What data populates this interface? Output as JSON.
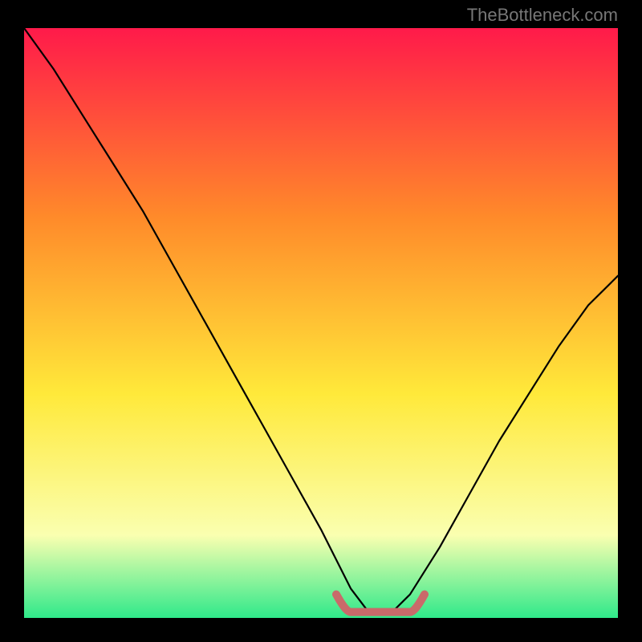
{
  "watermark": "TheBottleneck.com",
  "chart_data": {
    "type": "line",
    "title": "",
    "xlabel": "",
    "ylabel": "",
    "xlim": [
      0,
      100
    ],
    "ylim": [
      0,
      100
    ],
    "note": "No tick labels are visible in the image; values below are estimated from the curve shape. The curve is a V-shaped bottleneck curve: high on the left, dropping to a flat minimum near x≈55–65, then rising on the right.",
    "curve": {
      "name": "bottleneck-curve",
      "x": [
        0,
        5,
        10,
        15,
        20,
        25,
        30,
        35,
        40,
        45,
        50,
        55,
        58,
        62,
        65,
        70,
        75,
        80,
        85,
        90,
        95,
        100
      ],
      "y": [
        100,
        93,
        85,
        77,
        69,
        60,
        51,
        42,
        33,
        24,
        15,
        5,
        1,
        1,
        4,
        12,
        21,
        30,
        38,
        46,
        53,
        58
      ]
    },
    "minimum_marker": {
      "x_start": 55,
      "x_end": 65,
      "y": 1,
      "color": "#c96a6a"
    },
    "background_gradient_colors": {
      "top": "#ff1a4a",
      "mid1": "#ff8a2a",
      "mid2": "#ffe93a",
      "mid3": "#faffb0",
      "bottom": "#2fe98a"
    },
    "curve_color": "#000000"
  }
}
